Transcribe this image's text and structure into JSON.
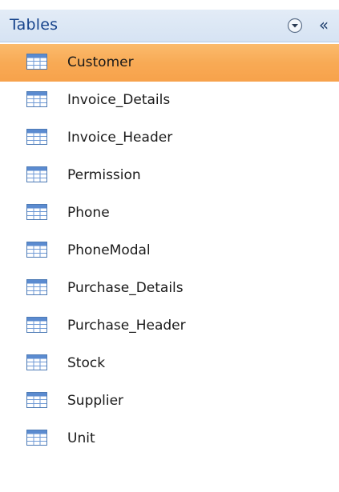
{
  "nav_pane": {
    "title": "Tables",
    "dropdown_icon": "chevron-down-circle-icon",
    "collapse_label": "«",
    "selected_color": "#f7a24b",
    "items": [
      {
        "label": "Customer",
        "icon": "table-icon",
        "selected": true
      },
      {
        "label": "Invoice_Details",
        "icon": "table-icon",
        "selected": false
      },
      {
        "label": "Invoice_Header",
        "icon": "table-icon",
        "selected": false
      },
      {
        "label": "Permission",
        "icon": "table-icon",
        "selected": false
      },
      {
        "label": "Phone",
        "icon": "table-icon",
        "selected": false
      },
      {
        "label": "PhoneModal",
        "icon": "table-icon",
        "selected": false
      },
      {
        "label": "Purchase_Details",
        "icon": "table-icon",
        "selected": false
      },
      {
        "label": "Purchase_Header",
        "icon": "table-icon",
        "selected": false
      },
      {
        "label": "Stock",
        "icon": "table-icon",
        "selected": false
      },
      {
        "label": "Supplier",
        "icon": "table-icon",
        "selected": false
      },
      {
        "label": "Unit",
        "icon": "table-icon",
        "selected": false
      }
    ]
  }
}
